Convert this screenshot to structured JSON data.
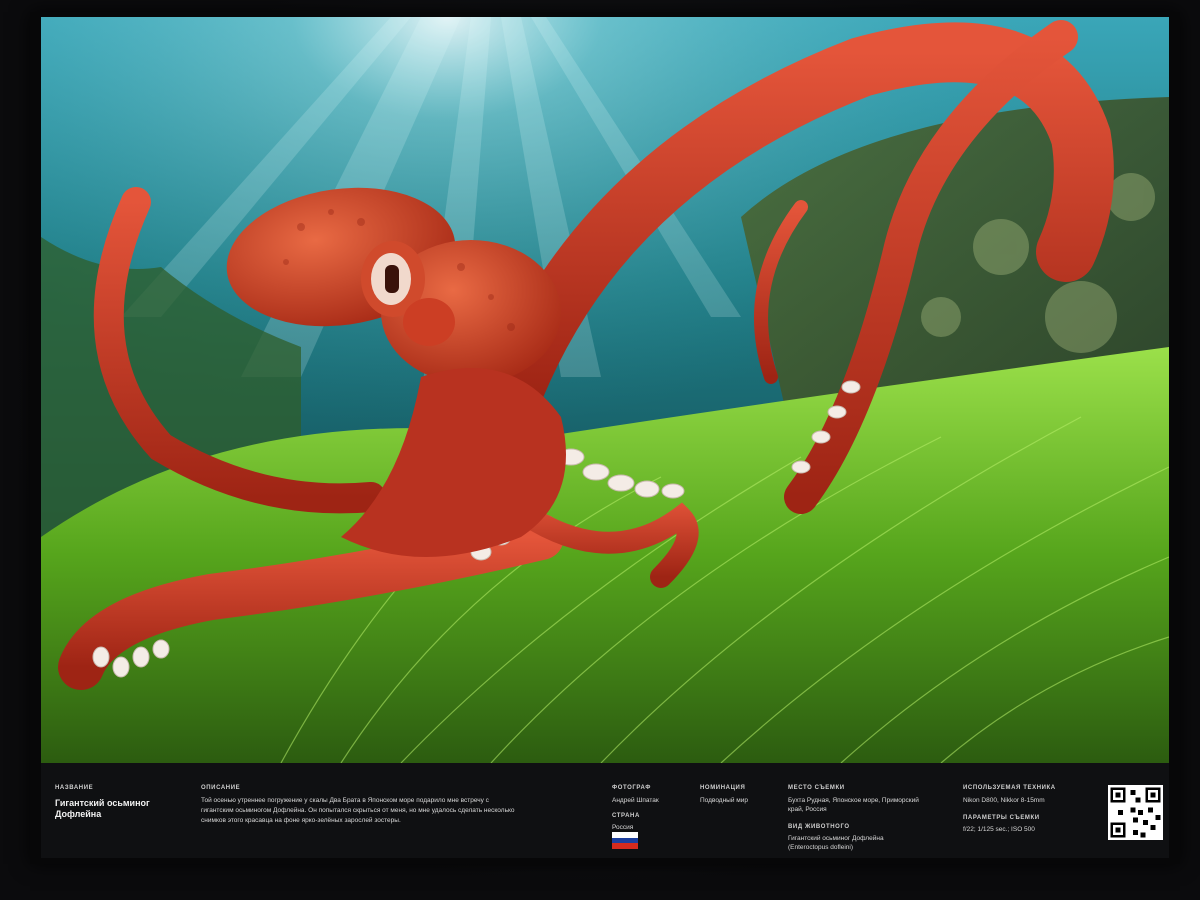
{
  "caption": {
    "title_label": "НАЗВАНИЕ",
    "title_line1": "Гигантский осьминог",
    "title_line2": "Дофлейна",
    "description_label": "ОПИСАНИЕ",
    "description_line1": "Той осенью утреннее погружение у скалы Два Брата в Японском море подарило мне встречу с",
    "description_line2": "гигантским осьминогом Дофлейна. Он попытался скрыться от меня, но мне удалось сделать несколько",
    "description_line3": "снимков этого красавца на фоне ярко-зелёных зарослей зостеры.",
    "photographer_label": "ФОТОГРАФ",
    "photographer": "Андрей Шпатак",
    "country_label": "СТРАНА",
    "country": "Россия",
    "nomination_label": "НОМИНАЦИЯ",
    "nomination": "Подводный мир",
    "location_label": "МЕСТО СЪЕМКИ",
    "location_line1": "Бухта Рудная, Японское море, Приморский",
    "location_line2": "край, Россия",
    "species_label": "ВИД ЖИВОТНОГО",
    "species_line1": "Гигантский осьминог Дофлейна",
    "species_line2": "(Enteroctopus dofleini)",
    "equipment_label": "ИСПОЛЬЗУЕМАЯ ТЕХНИКА",
    "equipment": "Nikon D800, Nikkor 8-15mm",
    "settings_label": "ПАРАМЕТРЫ СЪЕМКИ",
    "settings": "f/22; 1/125 sec.; ISO 500"
  },
  "colors": {
    "water_top": "#2a8fa6",
    "water_deep": "#0e4f5c",
    "seagrass": "#6fbf2a",
    "octopus": "#c8321c",
    "octopus_light": "#e5583a",
    "suckers": "#f4ece6",
    "flag_white": "#ffffff",
    "flag_blue": "#1c3f9e",
    "flag_red": "#d52b1e"
  }
}
